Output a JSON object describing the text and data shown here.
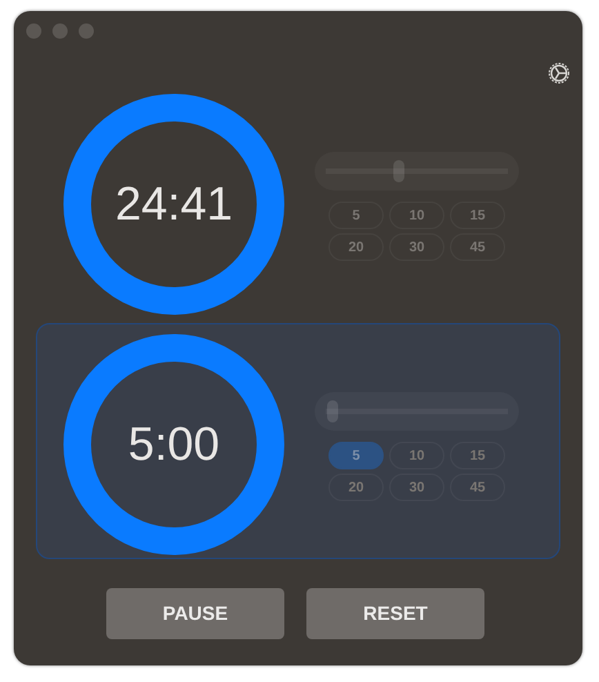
{
  "timers": [
    {
      "time": "24:41",
      "selected": false,
      "slider": {
        "level": 0.4
      },
      "presets": [
        {
          "label": "5",
          "selected": false
        },
        {
          "label": "10",
          "selected": false
        },
        {
          "label": "15",
          "selected": false
        },
        {
          "label": "20",
          "selected": false
        },
        {
          "label": "30",
          "selected": false
        },
        {
          "label": "45",
          "selected": false
        }
      ]
    },
    {
      "time": "5:00",
      "selected": true,
      "slider": {
        "level": 0.04
      },
      "presets": [
        {
          "label": "5",
          "selected": true
        },
        {
          "label": "10",
          "selected": false
        },
        {
          "label": "15",
          "selected": false
        },
        {
          "label": "20",
          "selected": false
        },
        {
          "label": "30",
          "selected": false
        },
        {
          "label": "45",
          "selected": false
        }
      ]
    }
  ],
  "buttons": [
    {
      "label": "PAUSE"
    },
    {
      "label": "RESET"
    }
  ]
}
